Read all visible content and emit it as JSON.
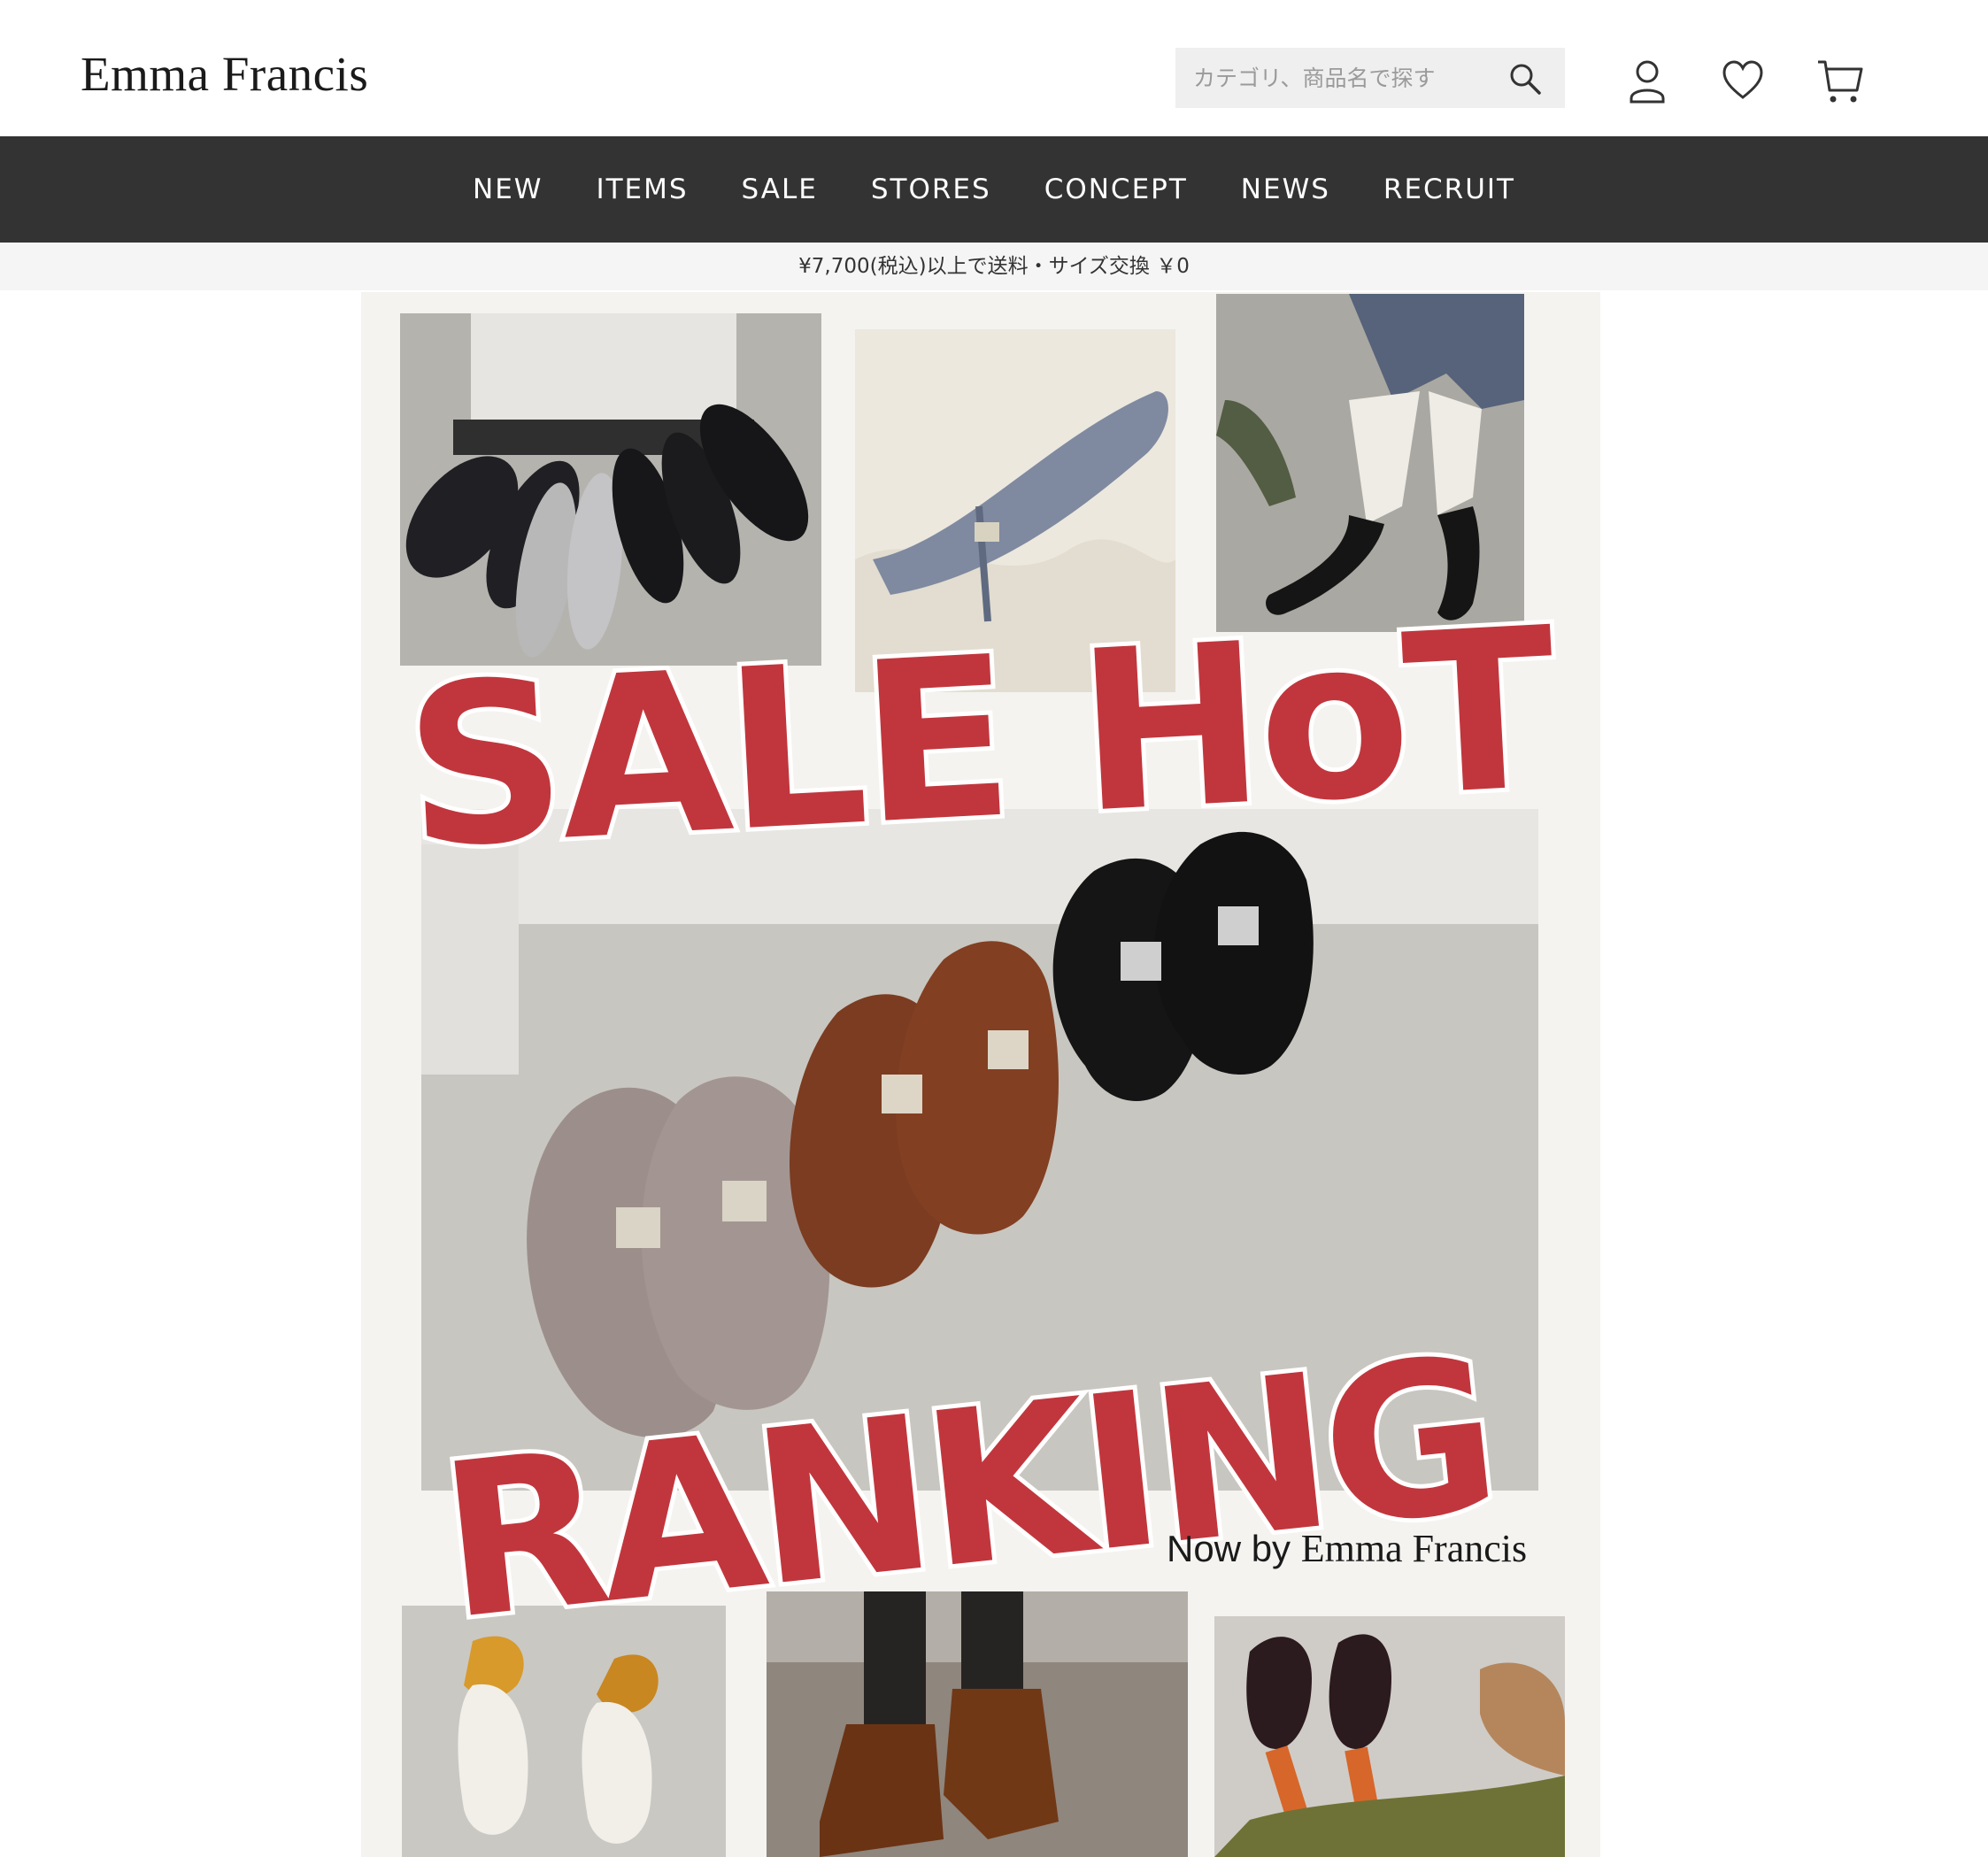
{
  "header": {
    "logo": "Emma Francis",
    "search": {
      "placeholder": "カテゴリ、商品名で探す"
    },
    "icons": [
      "search-icon",
      "user-icon",
      "heart-icon",
      "cart-icon"
    ]
  },
  "nav": {
    "items": [
      "NEW",
      "ITEMS",
      "SALE",
      "STORES",
      "CONCEPT",
      "NEWS",
      "RECRUIT"
    ]
  },
  "notice": "¥7,700(税込)以上で送料・サイズ交換 ￥0",
  "banner": {
    "headline_1": "SALE HoT",
    "headline_2": "RANKING",
    "byline_prefix": "Now by",
    "byline_brand": "Emma Francis",
    "colors": {
      "headline": "#c1363d",
      "nav_bg": "#333333"
    }
  }
}
